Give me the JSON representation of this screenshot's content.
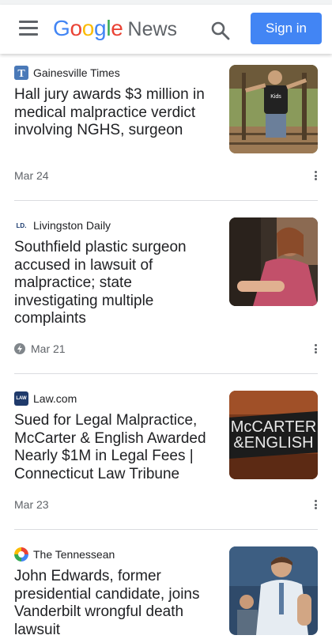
{
  "header": {
    "logo_google": [
      "G",
      "o",
      "o",
      "g",
      "l",
      "e"
    ],
    "logo_colors": [
      "#4285f4",
      "#ea4335",
      "#fbbc05",
      "#4285f4",
      "#34a853",
      "#ea4335"
    ],
    "logo_news": "News",
    "signin_label": "Sign in",
    "icons": {
      "menu": "menu-icon",
      "search": "search-icon"
    },
    "accent": "#4285f4"
  },
  "articles": [
    {
      "source": "Gainesville Times",
      "source_icon_text": "",
      "headline": "Hall jury awards $3 million in medical malpractice verdict involving NGHS, surgeon",
      "date": "Mar 24",
      "amp": false
    },
    {
      "source": "Livingston Daily",
      "source_icon_text": "LD.",
      "headline": "Southfield plastic surgeon accused in lawsuit of malpractice; state investigating multiple complaints",
      "date": "Mar 21",
      "amp": true
    },
    {
      "source": "Law.com",
      "source_icon_text": "LAW",
      "headline": "Sued for Legal Malpractice, McCarter & English Awarded Nearly $1M in Legal Fees | Connecticut Law Tribune",
      "date": "Mar 23",
      "amp": false,
      "thumb_text": [
        "McCARTER",
        "&ENGLISH"
      ]
    },
    {
      "source": "The Tennessean",
      "source_icon_text": "",
      "headline": "John Edwards, former presidential candidate, joins Vanderbilt wrongful death lawsuit",
      "date": "",
      "amp": false
    }
  ]
}
